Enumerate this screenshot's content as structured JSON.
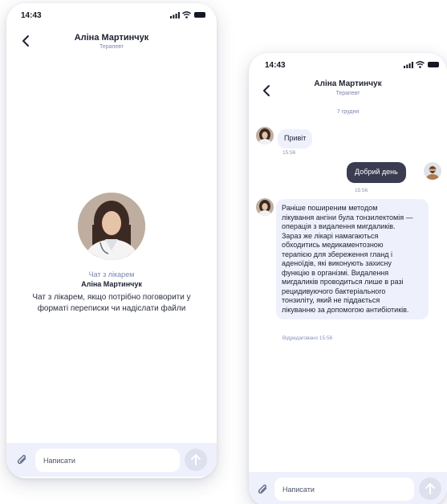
{
  "left_screen": {
    "status_time": "14:43",
    "doctor_name": "Аліна Мартинчук",
    "doctor_role": "Терапевт",
    "intro_label": "Чат з лікарем",
    "intro_name": "Аліна Мартинчук",
    "intro_description": "Чат з лікарем, якщо потрібно поговорити у форматі переписки чи надіслати файли",
    "composer_placeholder": "Написати"
  },
  "right_screen": {
    "status_time": "14:43",
    "doctor_name": "Аліна Мартинчук",
    "doctor_role": "Терапевт",
    "date_label": "7 грудня",
    "messages": [
      {
        "direction": "incoming",
        "text": "Привіт",
        "time": "15:56"
      },
      {
        "direction": "outgoing",
        "text": "Добрий день",
        "time": "15:56"
      },
      {
        "direction": "incoming",
        "lines": [
          "Раніше поширеним методом",
          "лікування ангіни була тонзилектомія —",
          "операція з видалення мигдаликів.",
          "Зараз же лікарі намагаються",
          "обходитись медикаментозною",
          "терапією для збереження гланд і",
          "аденоїдів, які виконують захисну",
          "функцію в організмі. Видалення",
          "мигдаликів проводиться лише в разі",
          "рецидивуючого бактеріального",
          "тонзиліту, який не піддається",
          "лікуванню за допомогою антибіотиків."
        ],
        "time": "Відредаговано 15:56"
      }
    ],
    "composer_placeholder": "Написати"
  },
  "colors": {
    "accent_muted": "#7a85b0",
    "incoming_bubble": "#eef1fb",
    "outgoing_bubble": "#3a3d51",
    "composer_bg": "#eef1fb",
    "send_button": "#dde1ee"
  },
  "icons": {
    "back": "chevron-left-icon",
    "attach": "paperclip-icon",
    "send": "arrow-up-icon",
    "signal": "signal-icon",
    "wifi": "wifi-icon",
    "battery": "battery-icon"
  }
}
